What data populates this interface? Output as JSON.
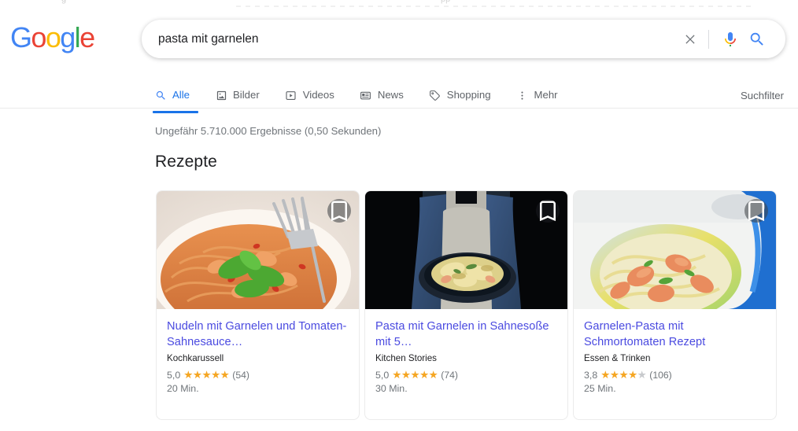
{
  "browser_sliver": {
    "left_ghost": "g",
    "right_ghost": "pp"
  },
  "header": {
    "logo_letters": [
      {
        "ch": "G",
        "color_class": "l-b"
      },
      {
        "ch": "o",
        "color_class": "l-r"
      },
      {
        "ch": "o",
        "color_class": "l-y"
      },
      {
        "ch": "g",
        "color_class": "l-b"
      },
      {
        "ch": "l",
        "color_class": "l-g"
      },
      {
        "ch": "e",
        "color_class": "l-r"
      }
    ],
    "logo_text": "Google",
    "search": {
      "value": "pasta mit garnelen",
      "placeholder": "",
      "clear_label": "Suche löschen",
      "voice_label": "Sprachsuche",
      "submit_label": "Google-Suche"
    },
    "tabs": [
      {
        "label": "Alle",
        "icon": "search-icon",
        "active": true
      },
      {
        "label": "Bilder",
        "icon": "image-icon",
        "active": false
      },
      {
        "label": "Videos",
        "icon": "video-icon",
        "active": false
      },
      {
        "label": "News",
        "icon": "news-icon",
        "active": false
      },
      {
        "label": "Shopping",
        "icon": "tag-icon",
        "active": false
      },
      {
        "label": "Mehr",
        "icon": "more-vertical-icon",
        "active": false
      }
    ],
    "tools_label": "Suchfilter"
  },
  "main": {
    "result_stats": "Ungefähr 5.710.000 Ergebnisse (0,50 Sekunden)",
    "section_title": "Rezepte",
    "recipes": [
      {
        "title": "Nudeln mit Garnelen und Tomaten-Sahnesauce…",
        "source": "Kochkarussell",
        "rating": "5,0",
        "stars_full": 5,
        "stars_empty": 0,
        "reviews": "(54)",
        "time": "20 Min.",
        "bookmark_label": "Speichern",
        "image_kind": "tomato-shrimp-pasta-white-bowl"
      },
      {
        "title": "Pasta mit Garnelen in Sahnesoße mit 5…",
        "source": "Kitchen Stories",
        "rating": "5,0",
        "stars_full": 5,
        "stars_empty": 0,
        "reviews": "(74)",
        "time": "30 Min.",
        "bookmark_label": "Speichern",
        "image_kind": "person-holding-bowl-dark"
      },
      {
        "title": "Garnelen-Pasta mit Schmortomaten Rezept",
        "source": "Essen & Trinken",
        "rating": "3,8",
        "stars_full": 4,
        "stars_empty": 1,
        "reviews": "(106)",
        "time": "25 Min.",
        "bookmark_label": "Speichern",
        "image_kind": "shrimp-pasta-colorful-bowl"
      }
    ]
  },
  "colors": {
    "google_blue": "#4285F4",
    "google_red": "#EA4335",
    "google_yellow": "#FBBC05",
    "google_green": "#34A853",
    "link_blue": "#4a4ae0",
    "active_tab": "#1a73e8",
    "star_gold": "#f5a623",
    "text_secondary": "#70757a"
  }
}
